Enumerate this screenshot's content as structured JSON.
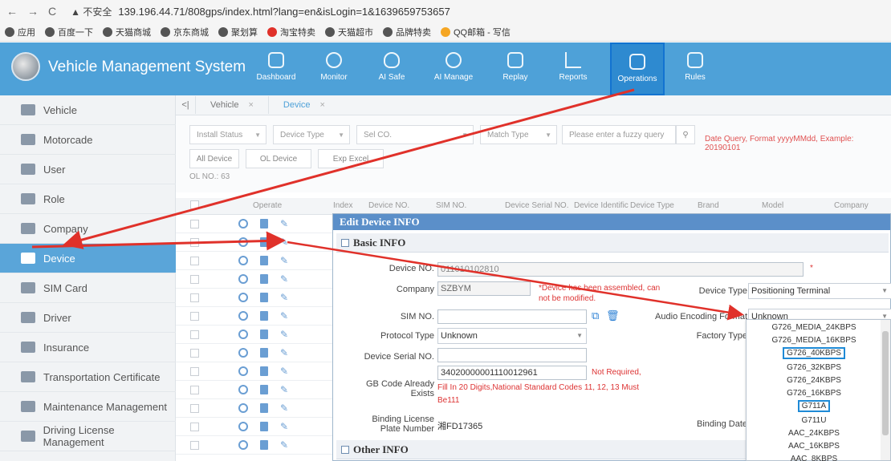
{
  "browser": {
    "security_label": "▲ 不安全",
    "url": "139.196.44.71/808gps/index.html?lang=en&isLogin=1&1639659753657",
    "bookmarks": [
      "应用",
      "百度一下",
      "天猫商城",
      "京东商城",
      "聚划算",
      "淘宝特卖",
      "天猫超市",
      "品牌特卖",
      "QQ邮箱 - 写信"
    ]
  },
  "header": {
    "title": "Vehicle Management System",
    "nav": [
      "Dashboard",
      "Monitor",
      "AI Safe",
      "AI Manage",
      "Replay",
      "Reports",
      "Operations",
      "Rules"
    ],
    "selected": "Operations"
  },
  "sidebar": {
    "items": [
      "Vehicle",
      "Motorcade",
      "User",
      "Role",
      "Company",
      "Device",
      "SIM Card",
      "Driver",
      "Insurance",
      "Transportation Certificate",
      "Maintenance Management",
      "Driving License Management"
    ],
    "selected": "Device"
  },
  "tabs": {
    "back": "<|",
    "items": [
      "Vehicle",
      "Device"
    ],
    "close": "×"
  },
  "filters": {
    "install_status": "Install Status",
    "device_type": "Device Type",
    "sel_co": "Sel CO.",
    "match_type": "Match Type",
    "search_placeholder": "Please enter a fuzzy query",
    "date_hint": "Date Query, Format yyyyMMdd, Example: 20190101",
    "all_device": "All Device",
    "ol_device": "OL Device",
    "excel": "Exp Excel",
    "ol_no": "OL NO.: 63"
  },
  "table": {
    "headers": [
      "Operate",
      "Index",
      "Device NO.",
      "SIM NO.",
      "Device Serial NO.",
      "Device Identific",
      "Device Type",
      "Brand",
      "Model",
      "Company"
    ]
  },
  "dialog": {
    "title": "Edit   Device INFO",
    "basic_section": "Basic INFO",
    "other_section": "Other INFO",
    "device_no_label": "Device NO.",
    "device_no_value": "011010102810",
    "device_no_required": "*",
    "company_label": "Company",
    "company_value": "SZBYM",
    "company_note": "*Device has been assembled, can not be modified.",
    "device_type_label": "Device Type",
    "device_type_value": "Positioning Terminal",
    "sim_label": "SIM NO.",
    "audio_label": "Audio Encoding Format",
    "audio_value": "Unknown",
    "protocol_label": "Protocol Type",
    "protocol_value": "Unknown",
    "factory_label": "Factory Type",
    "serial_label": "Device Serial NO.",
    "gb_label": "GB Code Already Exists",
    "gb_value": "34020000001110012961",
    "gb_note1": "Not Required,",
    "gb_note2": "Fill In 20 Digits,National Standard Codes 11, 12, 13 Must Be111",
    "binding_plate_label": "Binding License Plate Number",
    "binding_plate_value": "湘FD17365",
    "binding_date_label": "Binding Date"
  },
  "dropdown": {
    "options": [
      "G726_MEDIA_24KBPS",
      "G726_MEDIA_16KBPS",
      "G726_40KBPS",
      "G726_32KBPS",
      "G726_24KBPS",
      "G726_16KBPS",
      "G711A",
      "G711U",
      "AAC_24KBPS",
      "AAC_16KBPS",
      "AAC_8KBPS"
    ],
    "highlighted": [
      "G726_40KBPS",
      "G711A"
    ]
  },
  "colors": {
    "header": "#4ea1d8",
    "sidebar_selected": "#5aa5d9",
    "highlight_box": "#1e8ad6",
    "arrow": "#e0312a"
  }
}
